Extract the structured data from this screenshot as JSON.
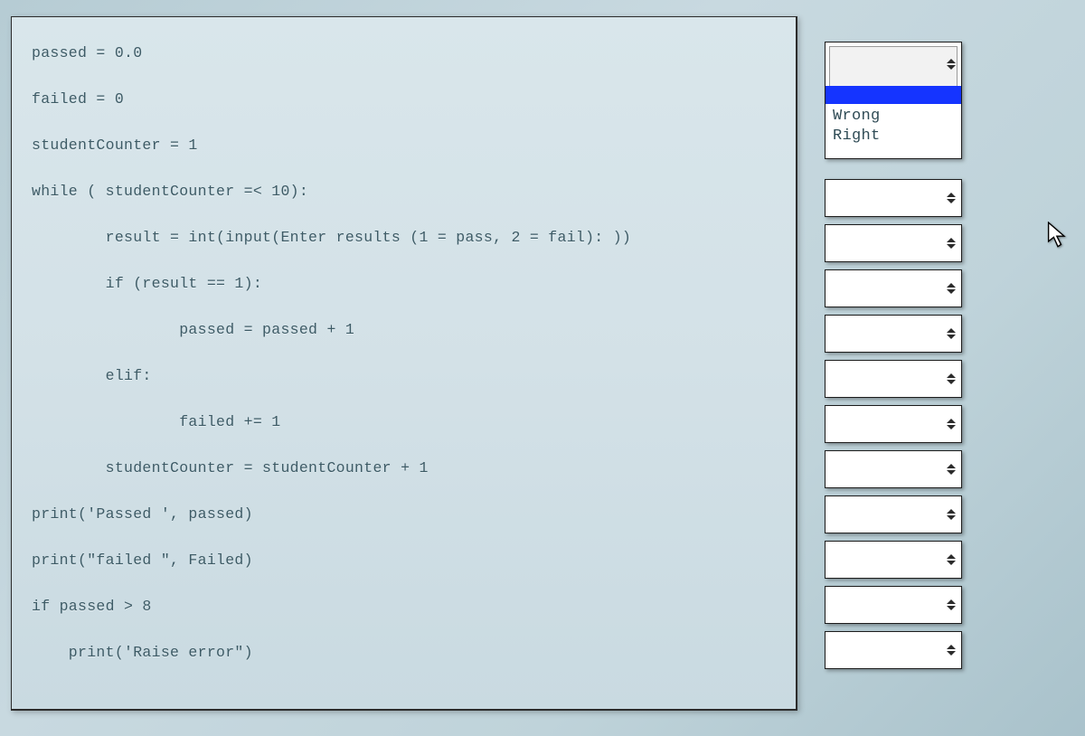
{
  "code": {
    "l1": "passed = 0.0",
    "l2": "failed = 0",
    "l3": "studentCounter = 1",
    "l4": "while ( studentCounter =< 10):",
    "l5": "        result = int(input(Enter results (1 = pass, 2 = fail): ))",
    "l6": "        if (result == 1):",
    "l7": "                passed = passed + 1",
    "l8": "        elif:",
    "l9": "                failed += 1",
    "l10": "        studentCounter = studentCounter + 1",
    "l11": "print('Passed ', passed)",
    "l12": "print(\"failed \", Failed)",
    "l13": "if passed > 8",
    "l14": "    print('Raise error\")"
  },
  "dropdown": {
    "opt1": "Wrong",
    "opt2": "Right"
  }
}
